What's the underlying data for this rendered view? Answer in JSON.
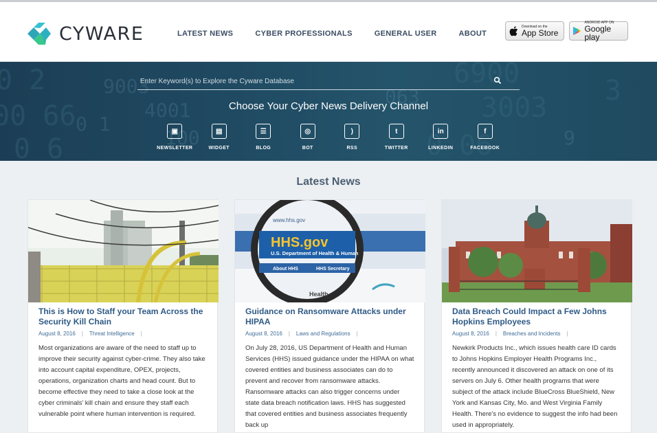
{
  "brand": {
    "name": "CYWARE"
  },
  "nav": {
    "items": [
      {
        "label": "LATEST NEWS"
      },
      {
        "label": "CYBER PROFESSIONALS"
      },
      {
        "label": "GENERAL USER"
      },
      {
        "label": "ABOUT"
      }
    ]
  },
  "stores": {
    "apple": {
      "small": "Download on the",
      "big": "App Store"
    },
    "google": {
      "small": "ANDROID APP ON",
      "big": "Google play"
    }
  },
  "hero": {
    "search_placeholder": "Enter Keyword(s) to Explore the Cyware Database",
    "title": "Choose Your Cyber News Delivery Channel",
    "channels": [
      {
        "label": "NEWSLETTER",
        "icon": "newsletter-icon",
        "glyph": "▣"
      },
      {
        "label": "WIDGET",
        "icon": "widget-icon",
        "glyph": "▤"
      },
      {
        "label": "BLOG",
        "icon": "blog-icon",
        "glyph": "☰"
      },
      {
        "label": "BOT",
        "icon": "bot-icon",
        "glyph": "◎"
      },
      {
        "label": "RSS",
        "icon": "rss-icon",
        "glyph": ")"
      },
      {
        "label": "TWITTER",
        "icon": "twitter-icon",
        "glyph": "t"
      },
      {
        "label": "LINKEDIN",
        "icon": "linkedin-icon",
        "glyph": "in"
      },
      {
        "label": "FACEBOOK",
        "icon": "facebook-icon",
        "glyph": "f"
      }
    ]
  },
  "latest": {
    "title": "Latest News",
    "cards": [
      {
        "title": "This is How to Staff your Team Across the Security Kill Chain",
        "date": "August 8, 2016",
        "category": "Threat Intelligence",
        "text": "Most organizations are aware of the need to staff up to improve their security against cyber-crime. They also take into account capital expenditure, OPEX, projects, operations, organization charts and head count. But to become effective they need to take a close look at the cyber criminals' kill chain and ensure they staff each vulnerable point where human intervention is required."
      },
      {
        "title": "Guidance on Ransomware Attacks under HIPAA",
        "date": "August 8, 2016",
        "category": "Laws and Regulations",
        "text": "On July 28, 2016, US Department of Health and Human Services (HHS) issued guidance under the HIPAA on what covered entities and business associates can do to prevent and recover from ransomware attacks. Ransomware attacks can also trigger concerns under state data breach notification laws. HHS has suggested that covered entities and business associates frequently back up",
        "img_text": {
          "url": "www.hhs.gov",
          "brand": "HHS.gov",
          "dept": "U.S. Department of Health & Human",
          "tab1": "About HHS",
          "tab2": "HHS Secretary",
          "health": "Health"
        }
      },
      {
        "title": "Data Breach Could Impact a Few Johns Hopkins Employees",
        "date": "August 8, 2016",
        "category": "Breaches and Incidents",
        "text": "Newkirk Products Inc., which issues health care ID cards to Johns Hopkins Employer Health Programs Inc., recently announced it discovered an attack on one of its servers on July 6. Other health programs that were subject of the attack include BlueCross BlueShield, New York and Kansas City, Mo. and West Virginia Family Health. There's no evidence to suggest the info had been used in appropriately."
      }
    ]
  },
  "colors": {
    "accent_teal": "#2ec4c2",
    "accent_green": "#38c98a",
    "link": "#2f5a86",
    "hero": "#1f4a62"
  }
}
